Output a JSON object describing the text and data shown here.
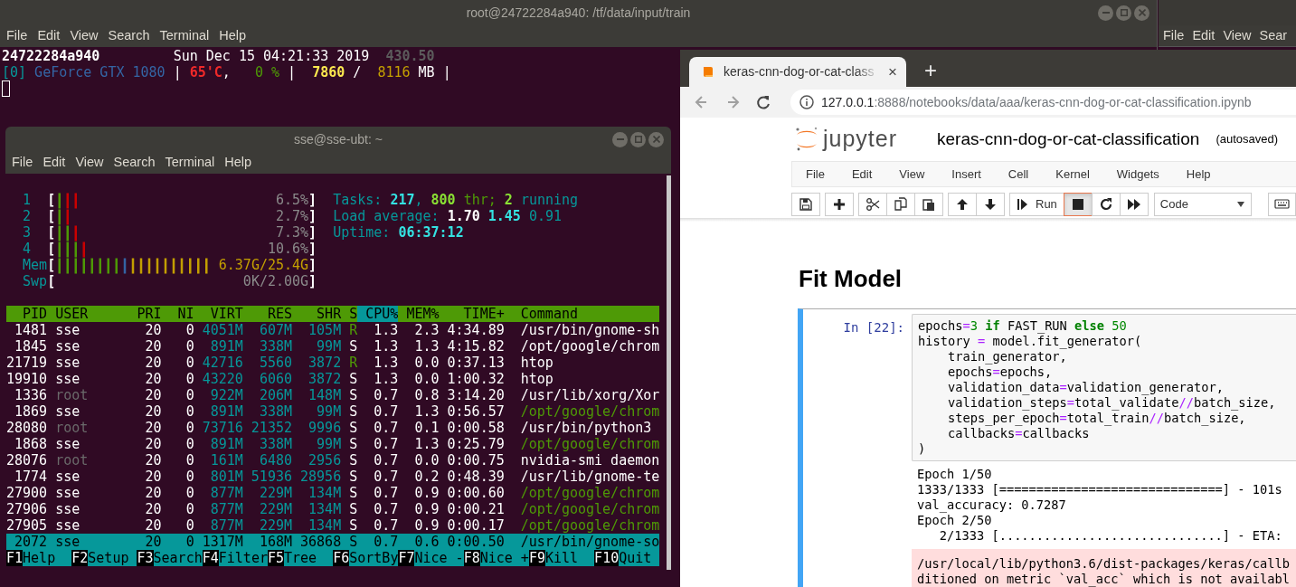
{
  "terminal_main": {
    "title": "root@24722284a940: /tf/data/input/train",
    "menu": [
      "File",
      "Edit",
      "View",
      "Search",
      "Terminal",
      "Help"
    ],
    "lines": [
      [
        {
          "text": "24722284a940",
          "bold": true
        },
        {
          "text": "         Sun Dec 15 04:21:33 2019  "
        },
        {
          "text": "430.50",
          "color": "#5c5c5c",
          "bold": true
        }
      ],
      [
        {
          "text": "[0]",
          "color": "#06989a"
        },
        {
          "text": " GeForce GTX 1080",
          "color": "#3465a4"
        },
        {
          "text": " | "
        },
        {
          "text": "65'C",
          "color": "#ef2929",
          "bold": true
        },
        {
          "text": ",   "
        },
        {
          "text": "0 %",
          "color": "#4e9a06"
        },
        {
          "text": " |  "
        },
        {
          "text": "7860",
          "color": "#fce94f",
          "bold": true
        },
        {
          "text": " /  "
        },
        {
          "text": "8116",
          "color": "#c4a000"
        },
        {
          "text": " MB |"
        }
      ]
    ]
  },
  "terminal_side": {
    "menu": [
      "File",
      "Edit",
      "View",
      "Sear"
    ]
  },
  "htop_window": {
    "title": "sse@sse-ubt: ~",
    "menu": [
      "File",
      "Edit",
      "View",
      "Search",
      "Terminal",
      "Help"
    ],
    "brackets": [
      "[",
      "]"
    ],
    "meters": [
      {
        "label": "1",
        "bar": [
          {
            "text": "|",
            "color": "#4e9a06"
          },
          {
            "text": "||",
            "color": "#cc0000"
          }
        ],
        "value": "6.5%",
        "color": "#8a8a8a"
      },
      {
        "label": "2",
        "bar": [
          {
            "text": "|",
            "color": "#4e9a06"
          },
          {
            "text": "|",
            "color": "#cc0000"
          }
        ],
        "value": "2.7%",
        "color": "#8a8a8a"
      },
      {
        "label": "3",
        "bar": [
          {
            "text": "||",
            "color": "#4e9a06"
          },
          {
            "text": "|",
            "color": "#cc0000"
          }
        ],
        "value": "7.3%",
        "color": "#8a8a8a"
      },
      {
        "label": "4",
        "bar": [
          {
            "text": "|||",
            "color": "#4e9a06"
          },
          {
            "text": "|",
            "color": "#cc0000"
          }
        ],
        "value": "10.6%",
        "color": "#8a8a8a"
      },
      {
        "label": "Mem",
        "bar": [
          {
            "text": "||||||||",
            "color": "#4e9a06"
          },
          {
            "text": "|",
            "color": "#3465a4"
          },
          {
            "text": "||||||||||",
            "color": "#c4a000"
          }
        ],
        "value": "6.37G/25.4G",
        "color": "#c4a000"
      },
      {
        "label": "Swp",
        "value": "0K/2.00G",
        "color": "#8a8a8a"
      }
    ],
    "stats": [
      [
        {
          "text": "Tasks: ",
          "color": "#06989a"
        },
        {
          "text": "217",
          "color": "#34e2e2",
          "bold": true
        },
        {
          "text": ", ",
          "color": "#06989a"
        },
        {
          "text": "800",
          "color": "#8ae234",
          "bold": true
        },
        {
          "text": " thr; ",
          "color": "#4e9a06"
        },
        {
          "text": "2",
          "color": "#8ae234",
          "bold": true
        },
        {
          "text": " running",
          "color": "#06989a"
        }
      ],
      [
        {
          "text": "Load average: ",
          "color": "#06989a"
        },
        {
          "text": "1.70 ",
          "color": "#ffffff",
          "bold": true
        },
        {
          "text": "1.45",
          "color": "#34e2e2",
          "bold": true
        },
        {
          "text": " 0.91",
          "color": "#06989a"
        }
      ],
      [
        {
          "text": "Uptime: ",
          "color": "#06989a"
        },
        {
          "text": "06:37:12",
          "color": "#34e2e2",
          "bold": true
        }
      ]
    ],
    "columns": [
      {
        "label": "PID",
        "sorted": false
      },
      {
        "label": "USER",
        "sorted": false
      },
      {
        "label": "PRI",
        "sorted": false
      },
      {
        "label": "NI",
        "sorted": false
      },
      {
        "label": "VIRT",
        "sorted": false
      },
      {
        "label": "RES",
        "sorted": false
      },
      {
        "label": "SHR",
        "sorted": false
      },
      {
        "label": "S",
        "sorted": false
      },
      {
        "label": "CPU%",
        "sorted": true
      },
      {
        "label": "MEM%",
        "sorted": false
      },
      {
        "label": "TIME+",
        "sorted": false
      },
      {
        "label": "Command",
        "sorted": false
      }
    ],
    "rows": [
      {
        "cells": [
          "1481",
          "sse",
          "20",
          "0",
          "4051M",
          "607M",
          "105M",
          "R",
          "1.3",
          "2.3",
          "4:34.89",
          "/usr/bin/gnome-sh"
        ],
        "running": true,
        "thread": false,
        "other_user": false,
        "selected": false
      },
      {
        "cells": [
          "1845",
          "sse",
          "20",
          "0",
          "891M",
          "338M",
          "99M",
          "S",
          "1.3",
          "1.3",
          "4:15.82",
          "/opt/google/chrom"
        ],
        "running": false,
        "thread": false,
        "other_user": false,
        "selected": false
      },
      {
        "cells": [
          "21719",
          "sse",
          "20",
          "0",
          "42716",
          "5560",
          "3872",
          "R",
          "1.3",
          "0.0",
          "0:37.13",
          "htop"
        ],
        "running": true,
        "thread": false,
        "other_user": false,
        "selected": false
      },
      {
        "cells": [
          "19910",
          "sse",
          "20",
          "0",
          "43220",
          "6060",
          "3872",
          "S",
          "1.3",
          "0.0",
          "1:00.32",
          "htop"
        ],
        "running": false,
        "thread": false,
        "other_user": false,
        "selected": false
      },
      {
        "cells": [
          "1336",
          "root",
          "20",
          "0",
          "922M",
          "206M",
          "148M",
          "S",
          "0.7",
          "0.8",
          "3:14.20",
          "/usr/lib/xorg/Xor"
        ],
        "running": false,
        "thread": false,
        "other_user": true,
        "selected": false
      },
      {
        "cells": [
          "1869",
          "sse",
          "20",
          "0",
          "891M",
          "338M",
          "99M",
          "S",
          "0.7",
          "1.3",
          "0:56.57",
          "/opt/google/chrom"
        ],
        "running": false,
        "thread": true,
        "other_user": false,
        "selected": false
      },
      {
        "cells": [
          "28080",
          "root",
          "20",
          "0",
          "73716",
          "21352",
          "9996",
          "S",
          "0.7",
          "0.1",
          "0:00.58",
          "/usr/bin/python3"
        ],
        "running": false,
        "thread": false,
        "other_user": true,
        "selected": false
      },
      {
        "cells": [
          "1868",
          "sse",
          "20",
          "0",
          "891M",
          "338M",
          "99M",
          "S",
          "0.7",
          "1.3",
          "0:25.79",
          "/opt/google/chrom"
        ],
        "running": false,
        "thread": true,
        "other_user": false,
        "selected": false
      },
      {
        "cells": [
          "28076",
          "root",
          "20",
          "0",
          "161M",
          "6480",
          "2956",
          "S",
          "0.7",
          "0.0",
          "0:00.75",
          "nvidia-smi daemon"
        ],
        "running": false,
        "thread": false,
        "other_user": true,
        "selected": false
      },
      {
        "cells": [
          "1774",
          "sse",
          "20",
          "0",
          "801M",
          "51936",
          "28956",
          "S",
          "0.7",
          "0.2",
          "0:48.39",
          "/usr/lib/gnome-te"
        ],
        "running": false,
        "thread": false,
        "other_user": false,
        "selected": false
      },
      {
        "cells": [
          "27900",
          "sse",
          "20",
          "0",
          "877M",
          "229M",
          "134M",
          "S",
          "0.7",
          "0.9",
          "0:00.60",
          "/opt/google/chrom"
        ],
        "running": false,
        "thread": true,
        "other_user": false,
        "selected": false
      },
      {
        "cells": [
          "27906",
          "sse",
          "20",
          "0",
          "877M",
          "229M",
          "134M",
          "S",
          "0.7",
          "0.9",
          "0:00.21",
          "/opt/google/chrom"
        ],
        "running": false,
        "thread": true,
        "other_user": false,
        "selected": false
      },
      {
        "cells": [
          "27905",
          "sse",
          "20",
          "0",
          "877M",
          "229M",
          "134M",
          "S",
          "0.7",
          "0.9",
          "0:00.17",
          "/opt/google/chrom"
        ],
        "running": false,
        "thread": true,
        "other_user": false,
        "selected": false
      },
      {
        "cells": [
          "2072",
          "sse",
          "20",
          "0",
          "1317M",
          "168M",
          "36868",
          "S",
          "0.7",
          "0.6",
          "0:00.50",
          "/usr/bin/gnome-so"
        ],
        "selected": true
      }
    ],
    "function_keys": [
      {
        "key": "F1",
        "label": "Help"
      },
      {
        "key": "F2",
        "label": "Setup"
      },
      {
        "key": "F3",
        "label": "Search"
      },
      {
        "key": "F4",
        "label": "Filter"
      },
      {
        "key": "F5",
        "label": "Tree"
      },
      {
        "key": "F6",
        "label": "SortBy"
      },
      {
        "key": "F7",
        "label": "Nice -"
      },
      {
        "key": "F8",
        "label": "Nice +"
      },
      {
        "key": "F9",
        "label": "Kill"
      },
      {
        "key": "F10",
        "label": "Quit"
      }
    ]
  },
  "browser": {
    "tab": {
      "title": "keras-cnn-dog-or-cat-class",
      "close": "×"
    },
    "new_tab": "+",
    "nav": [
      {
        "kind": "back",
        "disabled": true
      },
      {
        "kind": "forward",
        "disabled": true
      },
      {
        "kind": "reload",
        "disabled": false
      }
    ],
    "address": {
      "host": "127.0.0.1",
      "path": ":8888/notebooks/data/aaa/keras-cnn-dog-or-cat-classification.ipynb"
    }
  },
  "jupyter": {
    "logo_text": "jupyter",
    "notebook_name": "keras-cnn-dog-or-cat-classification",
    "save_status": "(autosaved)",
    "menu": [
      "File",
      "Edit",
      "View",
      "Insert",
      "Cell",
      "Kernel",
      "Widgets",
      "Help"
    ],
    "toolbar": [
      [
        {
          "kind": "save",
          "active": false
        }
      ],
      [
        {
          "kind": "insert",
          "active": false
        }
      ],
      [
        {
          "kind": "cut",
          "active": false
        },
        {
          "kind": "copy",
          "active": false
        },
        {
          "kind": "paste",
          "active": false
        }
      ],
      [
        {
          "kind": "up",
          "active": false
        },
        {
          "kind": "down",
          "active": false
        }
      ],
      [
        {
          "kind": "run",
          "label": "Run",
          "active": false
        },
        {
          "kind": "stop",
          "active": true
        },
        {
          "kind": "restart",
          "active": false
        },
        {
          "kind": "fast-forward",
          "active": false
        }
      ]
    ],
    "cell_type": "Code",
    "heading": "Fit Model",
    "cell": {
      "prompt": "In [22]:",
      "selected": true,
      "code": [
        [
          {
            "text": "epochs"
          },
          {
            "text": "=",
            "color": "#aa22ff"
          },
          {
            "text": "3",
            "color": "#008800"
          },
          {
            "text": " if",
            "color": "#008000",
            "bold": true
          },
          {
            "text": " FAST_RUN "
          },
          {
            "text": "else",
            "color": "#008000",
            "bold": true
          },
          {
            "text": " 50",
            "color": "#008800"
          }
        ],
        [
          {
            "text": "history "
          },
          {
            "text": "=",
            "color": "#aa22ff"
          },
          {
            "text": " model.fit_generator("
          }
        ],
        [
          {
            "text": "    train_generator,"
          }
        ],
        [
          {
            "text": "    epochs"
          },
          {
            "text": "=",
            "color": "#aa22ff"
          },
          {
            "text": "epochs,"
          }
        ],
        [
          {
            "text": "    validation_data"
          },
          {
            "text": "=",
            "color": "#aa22ff"
          },
          {
            "text": "validation_generator,"
          }
        ],
        [
          {
            "text": "    validation_steps"
          },
          {
            "text": "=",
            "color": "#aa22ff"
          },
          {
            "text": "total_validate"
          },
          {
            "text": "//",
            "color": "#aa22ff"
          },
          {
            "text": "batch_size,"
          }
        ],
        [
          {
            "text": "    steps_per_epoch"
          },
          {
            "text": "=",
            "color": "#aa22ff"
          },
          {
            "text": "total_train"
          },
          {
            "text": "//",
            "color": "#aa22ff"
          },
          {
            "text": "batch_size,"
          }
        ],
        [
          {
            "text": "    callbacks"
          },
          {
            "text": "=",
            "color": "#aa22ff"
          },
          {
            "text": "callbacks"
          }
        ],
        [
          {
            "text": ")"
          }
        ]
      ],
      "output": [
        "Epoch 1/50",
        "1333/1333 [==============================] - 101s",
        "val_accuracy: 0.7287",
        "Epoch 2/50",
        "   2/1333 [..............................] - ETA:"
      ],
      "stderr": [
        "/usr/local/lib/python3.6/dist-packages/keras/callb",
        "ditioned on metric `val_acc` which is not availabl"
      ]
    }
  }
}
